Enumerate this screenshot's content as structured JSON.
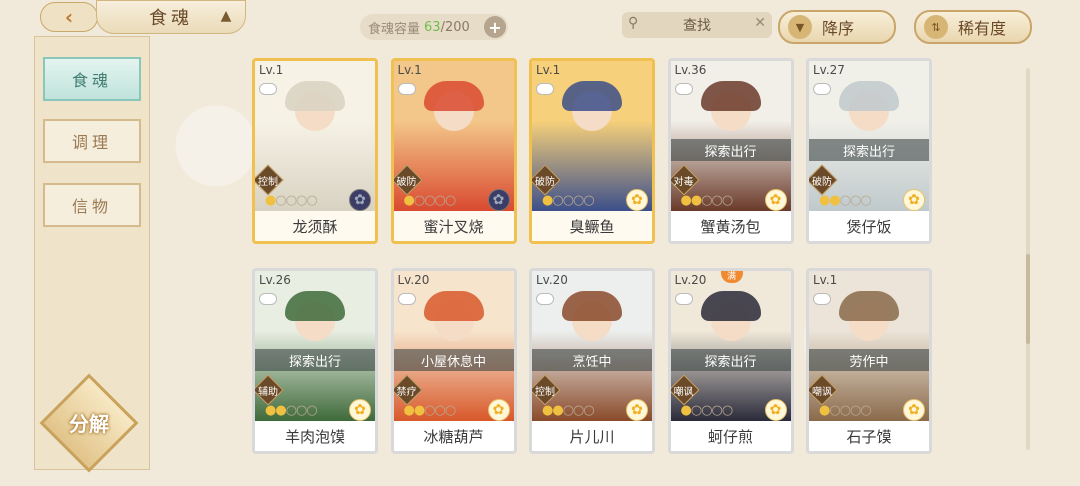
{
  "header": {
    "title": "食魂",
    "capacity_label": "食魂容量",
    "capacity_current": "63",
    "capacity_total": "/200",
    "search_placeholder": "查找",
    "sort_order": "降序",
    "sort_by": "稀有度"
  },
  "sidebar": {
    "items": [
      {
        "label": "食魂",
        "active": true
      },
      {
        "label": "调理",
        "active": false
      },
      {
        "label": "信物",
        "active": false
      }
    ],
    "decompose": "分解"
  },
  "cards": [
    {
      "level": "Lv.1",
      "name": "龙须酥",
      "role": "控制",
      "status": "",
      "stars_filled": 1,
      "gold": true,
      "element": "dark"
    },
    {
      "level": "Lv.1",
      "name": "蜜汁叉烧",
      "role": "破防",
      "status": "",
      "stars_filled": 1,
      "gold": true,
      "element": "dark"
    },
    {
      "level": "Lv.1",
      "name": "臭鳜鱼",
      "role": "破防",
      "status": "",
      "stars_filled": 1,
      "gold": true,
      "element": "light"
    },
    {
      "level": "Lv.36",
      "name": "蟹黄汤包",
      "role": "对毒",
      "status": "探索出行",
      "stars_filled": 2,
      "gold": false,
      "element": "light"
    },
    {
      "level": "Lv.27",
      "name": "煲仔饭",
      "role": "破防",
      "status": "探索出行",
      "stars_filled": 2,
      "gold": false,
      "element": "light"
    },
    {
      "level": "Lv.26",
      "name": "羊肉泡馍",
      "role": "辅助",
      "status": "探索出行",
      "stars_filled": 2,
      "gold": false,
      "element": "light"
    },
    {
      "level": "Lv.20",
      "name": "冰糖葫芦",
      "role": "禁疗",
      "status": "小屋休息中",
      "stars_filled": 2,
      "gold": false,
      "element": "light"
    },
    {
      "level": "Lv.20",
      "name": "片儿川",
      "role": "控制",
      "status": "烹饪中",
      "stars_filled": 2,
      "gold": false,
      "element": "light"
    },
    {
      "level": "Lv.20",
      "name": "蚵仔煎",
      "role": "嘲讽",
      "status": "探索出行",
      "stars_filled": 1,
      "gold": false,
      "element": "light",
      "badge": "满"
    },
    {
      "level": "Lv.1",
      "name": "石子馍",
      "role": "嘲讽",
      "status": "劳作中",
      "stars_filled": 1,
      "gold": false,
      "element": "light"
    }
  ]
}
